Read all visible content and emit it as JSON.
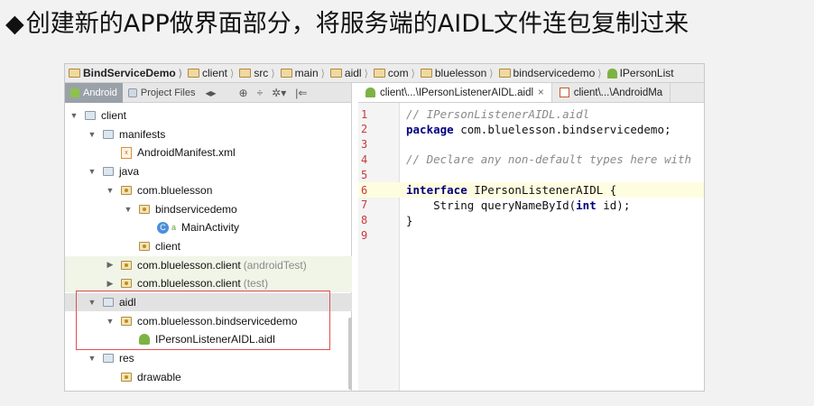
{
  "slide": {
    "bullet": "◆",
    "title": "创建新的APP做界面部分，将服务端的AIDL文件连包复制过来"
  },
  "breadcrumbs": [
    {
      "label": "BindServiceDemo",
      "icon": "folder-icon"
    },
    {
      "label": "client",
      "icon": "folder-icon"
    },
    {
      "label": "src",
      "icon": "folder-icon"
    },
    {
      "label": "main",
      "icon": "folder-icon"
    },
    {
      "label": "aidl",
      "icon": "folder-icon"
    },
    {
      "label": "com",
      "icon": "folder-icon"
    },
    {
      "label": "bluelesson",
      "icon": "folder-icon"
    },
    {
      "label": "bindservicedemo",
      "icon": "folder-icon"
    },
    {
      "label": "IPersonList",
      "icon": "android-icon"
    }
  ],
  "tool_tabs": {
    "android": "Android",
    "project_files": "Project Files",
    "icons": [
      "◂▸",
      "⊕",
      "÷",
      "✲▾",
      "|⇐"
    ]
  },
  "tree": [
    {
      "label": "client",
      "dim": "",
      "icon": "module",
      "arrow": "▼",
      "indent": 0
    },
    {
      "label": "manifests",
      "dim": "",
      "icon": "folder",
      "arrow": "▼",
      "indent": 1
    },
    {
      "label": "AndroidManifest.xml",
      "dim": "",
      "icon": "xml",
      "arrow": "",
      "indent": 2
    },
    {
      "label": "java",
      "dim": "",
      "icon": "folder",
      "arrow": "▼",
      "indent": 1
    },
    {
      "label": "com.bluelesson",
      "dim": "",
      "icon": "package",
      "arrow": "▼",
      "indent": 2
    },
    {
      "label": "bindservicedemo",
      "dim": "",
      "icon": "package",
      "arrow": "▼",
      "indent": 3
    },
    {
      "label": "MainActivity",
      "dim": "",
      "icon": "class",
      "arrow": "",
      "indent": 4
    },
    {
      "label": "client",
      "dim": "",
      "icon": "package",
      "arrow": "",
      "indent": 3
    },
    {
      "label": "com.bluelesson.client",
      "dim": "(androidTest)",
      "icon": "package",
      "arrow": "▶",
      "indent": 2
    },
    {
      "label": "com.bluelesson.client",
      "dim": "(test)",
      "icon": "package",
      "arrow": "▶",
      "indent": 2
    },
    {
      "label": "aidl",
      "dim": "",
      "icon": "folder",
      "arrow": "▼",
      "indent": 1
    },
    {
      "label": "com.bluelesson.bindservicedemo",
      "dim": "",
      "icon": "package",
      "arrow": "▼",
      "indent": 2
    },
    {
      "label": "IPersonListenerAIDL.aidl",
      "dim": "",
      "icon": "android",
      "arrow": "",
      "indent": 3
    },
    {
      "label": "res",
      "dim": "",
      "icon": "folder",
      "arrow": "▼",
      "indent": 1
    },
    {
      "label": "drawable",
      "dim": "",
      "icon": "package",
      "arrow": "",
      "indent": 2
    }
  ],
  "editor_tabs": [
    {
      "label": "client\\...\\IPersonListenerAIDL.aidl",
      "close": "×",
      "icon": "android-icon",
      "active": true
    },
    {
      "label": "client\\...\\AndroidMa",
      "close": "",
      "icon": "java-icon",
      "active": false
    }
  ],
  "code_lines": [
    {
      "n": "1",
      "text": "// IPersonListenerAIDL.aidl",
      "kind": "comment"
    },
    {
      "n": "2",
      "kw": "package",
      "text": " com.bluelesson.bindservicedemo;",
      "kind": "kw"
    },
    {
      "n": "3",
      "text": "",
      "kind": "plain"
    },
    {
      "n": "4",
      "text": "// Declare any non-default types here with",
      "kind": "comment"
    },
    {
      "n": "5",
      "text": "",
      "kind": "plain"
    },
    {
      "n": "6",
      "kw": "interface",
      "text": " IPersonListenerAIDL {",
      "kind": "kw",
      "current": true
    },
    {
      "n": "7",
      "pre": "    String queryNameById(",
      "kw": "int",
      "text": " id);",
      "kind": "mixed"
    },
    {
      "n": "8",
      "text": "}",
      "kind": "plain"
    },
    {
      "n": "9",
      "text": "",
      "kind": "plain"
    }
  ]
}
